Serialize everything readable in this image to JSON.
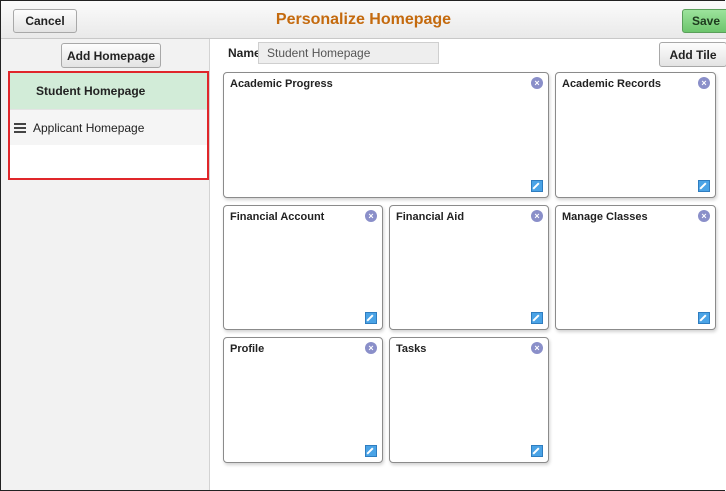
{
  "header": {
    "cancel_label": "Cancel",
    "title": "Personalize Homepage",
    "save_label": "Save"
  },
  "sidebar": {
    "add_homepage_label": "Add Homepage",
    "items": [
      {
        "label": "Student Homepage",
        "selected": true
      },
      {
        "label": "Applicant Homepage",
        "selected": false
      }
    ]
  },
  "main": {
    "name_label": "Name",
    "name_value": "Student Homepage",
    "add_tile_label": "Add Tile",
    "tiles": [
      {
        "title": "Academic Progress"
      },
      {
        "title": "Academic Records"
      },
      {
        "title": "Financial Account"
      },
      {
        "title": "Financial Aid"
      },
      {
        "title": "Manage Classes"
      },
      {
        "title": "Profile"
      },
      {
        "title": "Tasks"
      }
    ]
  },
  "colors": {
    "title_orange": "#c46a0e",
    "save_green": "#6cc56c",
    "selected_item": "#d2ecd8",
    "highlight_border": "#e0262a",
    "close_icon": "#8a8fc9",
    "edit_icon": "#4aa3e6"
  }
}
